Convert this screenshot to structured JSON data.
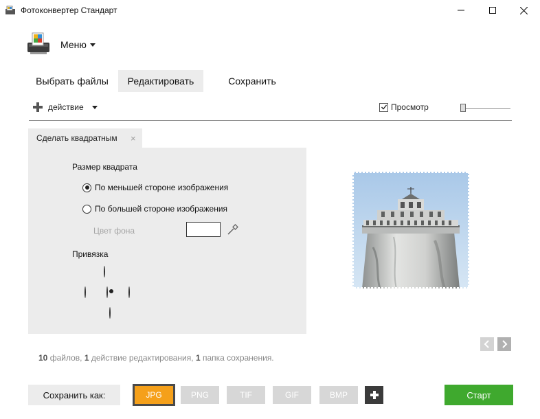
{
  "window": {
    "title": "Фотоконвертер Стандарт",
    "minimize_icon": "minimize-icon",
    "maximize_icon": "maximize-icon",
    "close_icon": "close-icon"
  },
  "menu": {
    "label": "Меню"
  },
  "tabs": [
    {
      "label": "Выбрать файлы",
      "active": false
    },
    {
      "label": "Редактировать",
      "active": true
    },
    {
      "label": "Сохранить",
      "active": false
    }
  ],
  "toolbar": {
    "action_label": "действие",
    "preview_label": "Просмотр",
    "preview_checked": true
  },
  "panel": {
    "tab_label": "Сделать квадратным",
    "tab_close": "×",
    "size_heading": "Размер квадрата",
    "option_smaller": "По меньшей стороне изображения",
    "option_larger": "По большей стороне изображения",
    "selected_option": "smaller",
    "bg_color_label": "Цвет фона",
    "bg_color_value": "#ffffff",
    "anchor_heading": "Привязка",
    "anchor_selected": "center"
  },
  "summary": {
    "files_count": "10",
    "files_text": "файлов,",
    "actions_count": "1",
    "actions_text": "действие редактирования,",
    "folders_count": "1",
    "folders_text": "папка сохранения."
  },
  "bottom": {
    "save_as_label": "Сохранить как:",
    "formats": [
      "JPG",
      "PNG",
      "TIF",
      "GIF",
      "BMP"
    ],
    "selected_format": "JPG",
    "start_label": "Старт"
  },
  "colors": {
    "accent_orange": "#f5a01a",
    "start_green": "#3fa92e",
    "panel_gray": "#ececec",
    "format_inactive": "#d7d7d7"
  }
}
